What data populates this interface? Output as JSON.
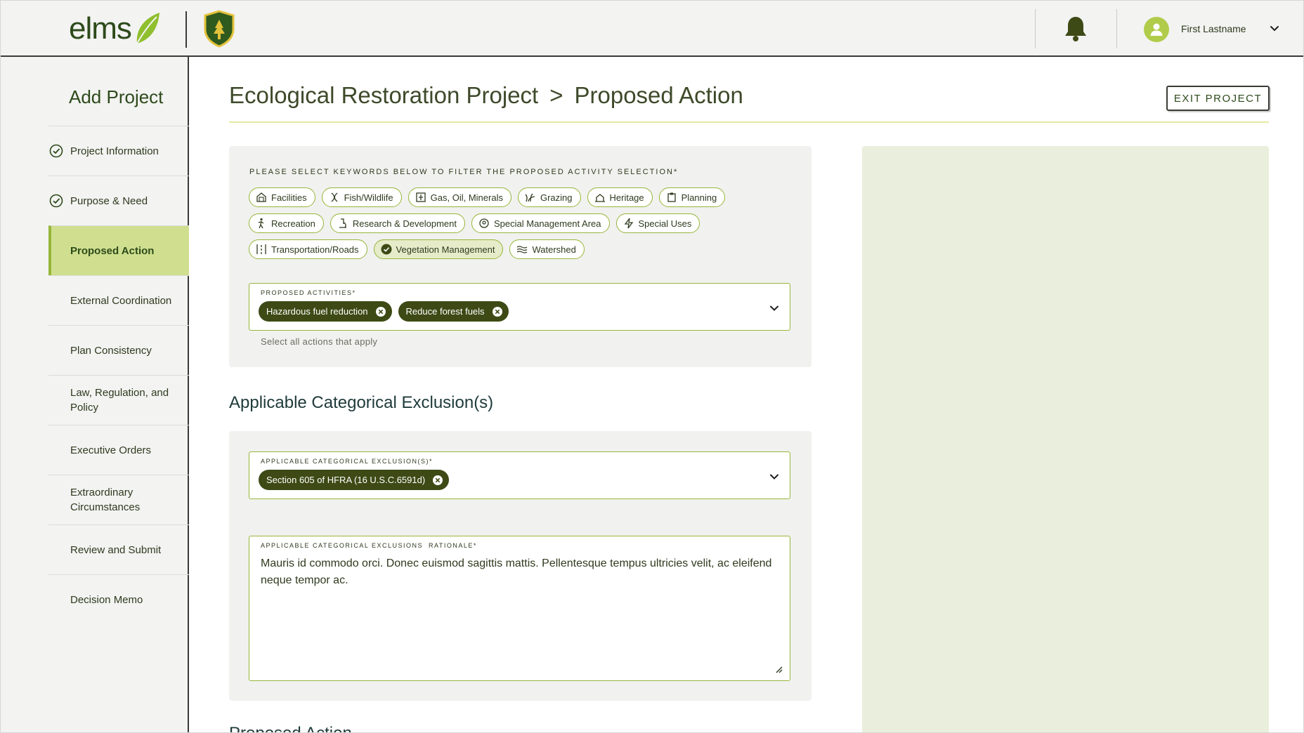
{
  "header": {
    "logo_text": "elms",
    "user_name": "First Lastname",
    "icons": [
      "leaf-icon",
      "usfs-shield-icon",
      "bell-icon",
      "user-icon",
      "chevron-down-icon"
    ]
  },
  "sidebar": {
    "title": "Add Project",
    "items": [
      {
        "label": "Project Information",
        "state": "complete"
      },
      {
        "label": "Purpose & Need",
        "state": "complete"
      },
      {
        "label": "Proposed Action",
        "state": "active"
      },
      {
        "label": "External Coordination",
        "state": "pending"
      },
      {
        "label": "Plan Consistency",
        "state": "pending"
      },
      {
        "label": "Law, Regulation, and Policy",
        "state": "pending"
      },
      {
        "label": "Executive Orders",
        "state": "pending"
      },
      {
        "label": "Extraordinary Circumstances",
        "state": "pending"
      },
      {
        "label": "Review and Submit",
        "state": "pending"
      },
      {
        "label": "Decision Memo",
        "state": "pending"
      }
    ]
  },
  "main": {
    "breadcrumb_project": "Ecological Restoration Project",
    "breadcrumb_sep": ">",
    "breadcrumb_page": "Proposed Action",
    "exit_button": "EXIT PROJECT",
    "filter_label": "PLEASE SELECT KEYWORDS BELOW TO FILTER THE PROPOSED ACTIVITY SELECTION*",
    "keywords": [
      {
        "label": "Facilities",
        "icon": "building-icon",
        "selected": false
      },
      {
        "label": "Fish/Wildlife",
        "icon": "fish-icon",
        "selected": false
      },
      {
        "label": "Gas, Oil, Minerals",
        "icon": "derrick-icon",
        "selected": false
      },
      {
        "label": "Grazing",
        "icon": "grass-icon",
        "selected": false
      },
      {
        "label": "Heritage",
        "icon": "landmark-icon",
        "selected": false
      },
      {
        "label": "Planning",
        "icon": "clipboard-icon",
        "selected": false
      },
      {
        "label": "Recreation",
        "icon": "hiker-icon",
        "selected": false
      },
      {
        "label": "Research & Development",
        "icon": "microscope-icon",
        "selected": false
      },
      {
        "label": "Special Management Area",
        "icon": "map-pin-icon",
        "selected": false
      },
      {
        "label": "Special Uses",
        "icon": "lightning-icon",
        "selected": false
      },
      {
        "label": "Transportation/Roads",
        "icon": "road-icon",
        "selected": false
      },
      {
        "label": "Vegetation Management",
        "icon": "check-circle-icon",
        "selected": true
      },
      {
        "label": "Watershed",
        "icon": "waves-icon",
        "selected": false
      }
    ],
    "proposed_activities": {
      "label": "PROPOSED ACTIVITIES*",
      "selected": [
        "Hazardous fuel reduction",
        "Reduce forest fuels"
      ],
      "helper": "Select all actions that apply"
    },
    "ce_section_heading": "Applicable Categorical Exclusion(s)",
    "ce_select": {
      "label": "APPLICABLE CATEGORICAL EXCLUSION(S)*",
      "selected": [
        "Section 605 of HFRA (16 U.S.C.6591d)"
      ]
    },
    "rationale": {
      "label": "APPLICABLE CATEGORICAL EXCLUSIONS  RATIONALE*",
      "value": "Mauris id commodo orci. Donec euismod sagittis mattis. Pellentesque tempus ultricies velit, ac eleifend neque tempor ac."
    },
    "next_heading_partial": "Proposed Action"
  },
  "colors": {
    "brand_dark": "#2d4a1a",
    "accent_green": "#97b53a",
    "active_nav": "#cfdf8f",
    "tag_bg": "#3d4a15",
    "panel_bg": "#e9efdc"
  }
}
